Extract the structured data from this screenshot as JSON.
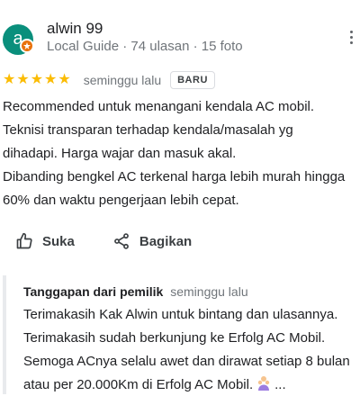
{
  "reviewer": {
    "avatar_letter": "a",
    "name": "alwin 99",
    "meta": "Local Guide · 74 ulasan · 15 foto"
  },
  "rating": {
    "stars": 5,
    "time": "seminggu lalu",
    "badge": "BARU"
  },
  "review_lines": [
    "Recommended untuk menangani kendala AC mobil.",
    "Teknisi transparan terhadap kendala/masalah yg",
    "dihadapi. Harga wajar dan masuk akal.",
    "Dibanding bengkel AC terkenal harga lebih murah hingga",
    "60% dan waktu pengerjaan lebih cepat."
  ],
  "actions": {
    "like_label": "Suka",
    "share_label": "Bagikan"
  },
  "owner_response": {
    "title": "Tanggapan dari pemilik",
    "time": "seminggu lalu",
    "lines": [
      "Terimakasih Kak Alwin untuk bintang dan ulasannya.",
      "Terimakasih sudah berkunjung ke Erfolg AC Mobil.",
      "Semoga ACnya selalu awet dan dirawat setiap 8 bulan",
      "atau per 20.000Km di Erfolg AC Mobil."
    ],
    "ellipsis": "..."
  },
  "colors": {
    "avatar": "#0a8f7c",
    "guide_badge": "#e8710a",
    "star": "#fbbc04"
  }
}
